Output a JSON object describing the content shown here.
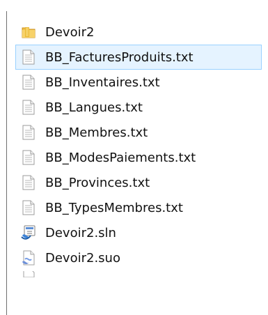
{
  "explorer": {
    "items": [
      {
        "name": "Devoir2",
        "icon": "folder-icon",
        "selected": false
      },
      {
        "name": "BB_FacturesProduits.txt",
        "icon": "text-file-icon",
        "selected": true
      },
      {
        "name": "BB_Inventaires.txt",
        "icon": "text-file-icon",
        "selected": false
      },
      {
        "name": "BB_Langues.txt",
        "icon": "text-file-icon",
        "selected": false
      },
      {
        "name": "BB_Membres.txt",
        "icon": "text-file-icon",
        "selected": false
      },
      {
        "name": "BB_ModesPaiements.txt",
        "icon": "text-file-icon",
        "selected": false
      },
      {
        "name": "BB_Provinces.txt",
        "icon": "text-file-icon",
        "selected": false
      },
      {
        "name": "BB_TypesMembres.txt",
        "icon": "text-file-icon",
        "selected": false
      },
      {
        "name": "Devoir2.sln",
        "icon": "visual-studio-solution-icon",
        "selected": false
      },
      {
        "name": "Devoir2.suo",
        "icon": "suo-file-icon",
        "selected": false
      }
    ]
  },
  "colors": {
    "selection_background": "#e5f3ff",
    "selection_border": "#99d1ff",
    "frame_border": "#6f6f6f"
  }
}
